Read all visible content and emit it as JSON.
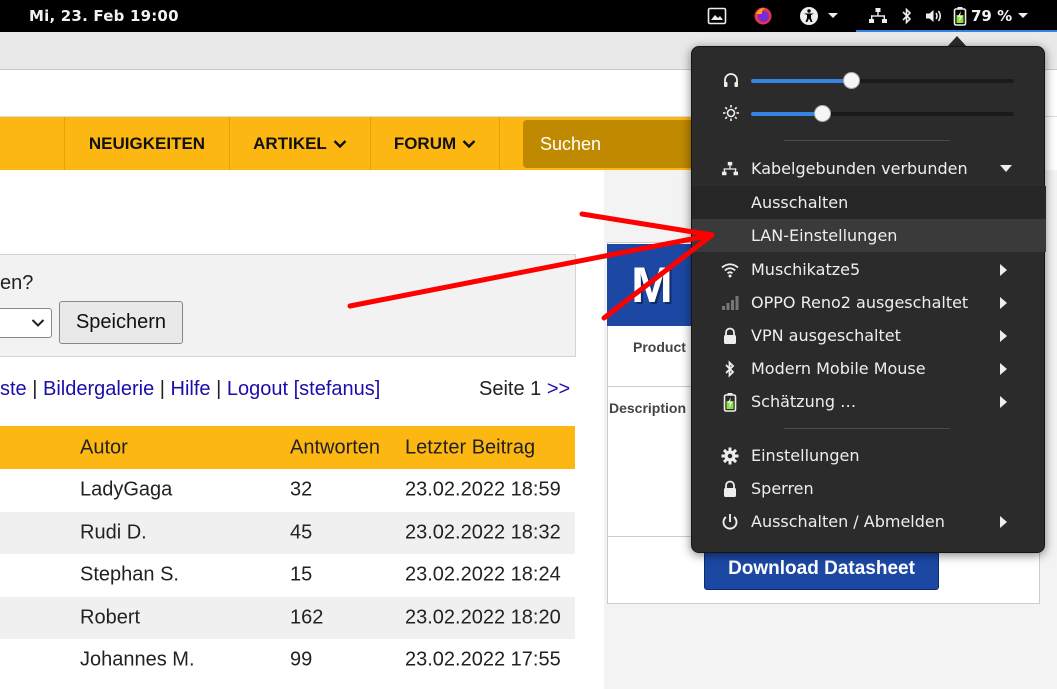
{
  "topbar": {
    "clock": "Mi, 23. Feb  19:00",
    "battery_percent": "79 %",
    "icons": [
      "screenshot-icon",
      "firefox-icon",
      "accessibility-icon",
      "network-wired-icon",
      "bluetooth-icon",
      "volume-icon",
      "battery-charging-icon"
    ]
  },
  "webpage": {
    "nav": [
      {
        "label": "NEUIGKEITEN",
        "has_dropdown": false
      },
      {
        "label": "ARTIKEL",
        "has_dropdown": true
      },
      {
        "label": "FORUM",
        "has_dropdown": true
      }
    ],
    "search_placeholder": "Suchen",
    "question_text": "en?",
    "save_button": "Speichern",
    "links": {
      "partial": "ste",
      "sep": "|",
      "gallery": "Bildergalerie",
      "help": "Hilfe",
      "logout": "Logout [stefanus]"
    },
    "page": {
      "label": "Seite 1",
      "next": ">>"
    },
    "table": {
      "headers": {
        "autor": "Autor",
        "antworten": "Antworten",
        "letzter": "Letzter Beitrag"
      },
      "rows": [
        {
          "autor": "LadyGaga",
          "antworten": "32",
          "letzter": "23.02.2022 18:59"
        },
        {
          "autor": "Rudi D.",
          "antworten": "45",
          "letzter": "23.02.2022 18:32"
        },
        {
          "autor": "Stephan S.",
          "antworten": "15",
          "letzter": "23.02.2022 18:24"
        },
        {
          "autor": "Robert",
          "antworten": "162",
          "letzter": "23.02.2022 18:20"
        },
        {
          "autor": "Johannes M.",
          "antworten": "99",
          "letzter": "23.02.2022 17:55"
        }
      ]
    },
    "product": {
      "logo_letter": "M",
      "product_label": "Product",
      "description_label": "Description",
      "download_button": "Download Datasheet"
    }
  },
  "system_menu": {
    "volume_level": 0.38,
    "brightness_level": 0.27,
    "wired": {
      "label": "Kabelgebunden verbunden",
      "icon": "network-wired-icon"
    },
    "wired_submenu": [
      {
        "label": "Ausschalten"
      },
      {
        "label": "LAN-Einstellungen",
        "highlighted": true
      }
    ],
    "items": [
      {
        "label": "Muschikatze5",
        "icon": "wifi-icon",
        "has_submenu": true
      },
      {
        "label": "OPPO Reno2 ausgeschaltet",
        "icon": "cellular-icon",
        "has_submenu": true
      },
      {
        "label": "VPN ausgeschaltet",
        "icon": "vpn-lock-icon",
        "has_submenu": true
      },
      {
        "label": "Modern Mobile Mouse",
        "icon": "bluetooth-icon",
        "has_submenu": true
      },
      {
        "label": "Schätzung …",
        "icon": "battery-charging-icon",
        "has_submenu": true
      }
    ],
    "bottom_items": [
      {
        "label": "Einstellungen",
        "icon": "gear-icon",
        "has_submenu": false
      },
      {
        "label": "Sperren",
        "icon": "lock-icon",
        "has_submenu": false
      },
      {
        "label": "Ausschalten / Abmelden",
        "icon": "power-icon",
        "has_submenu": true
      }
    ],
    "colors": {
      "accent": "#3584e4",
      "menu_bg": "#2b2b2b",
      "nav_bg": "#fdb713",
      "annotation_red": "#ff0000"
    }
  }
}
